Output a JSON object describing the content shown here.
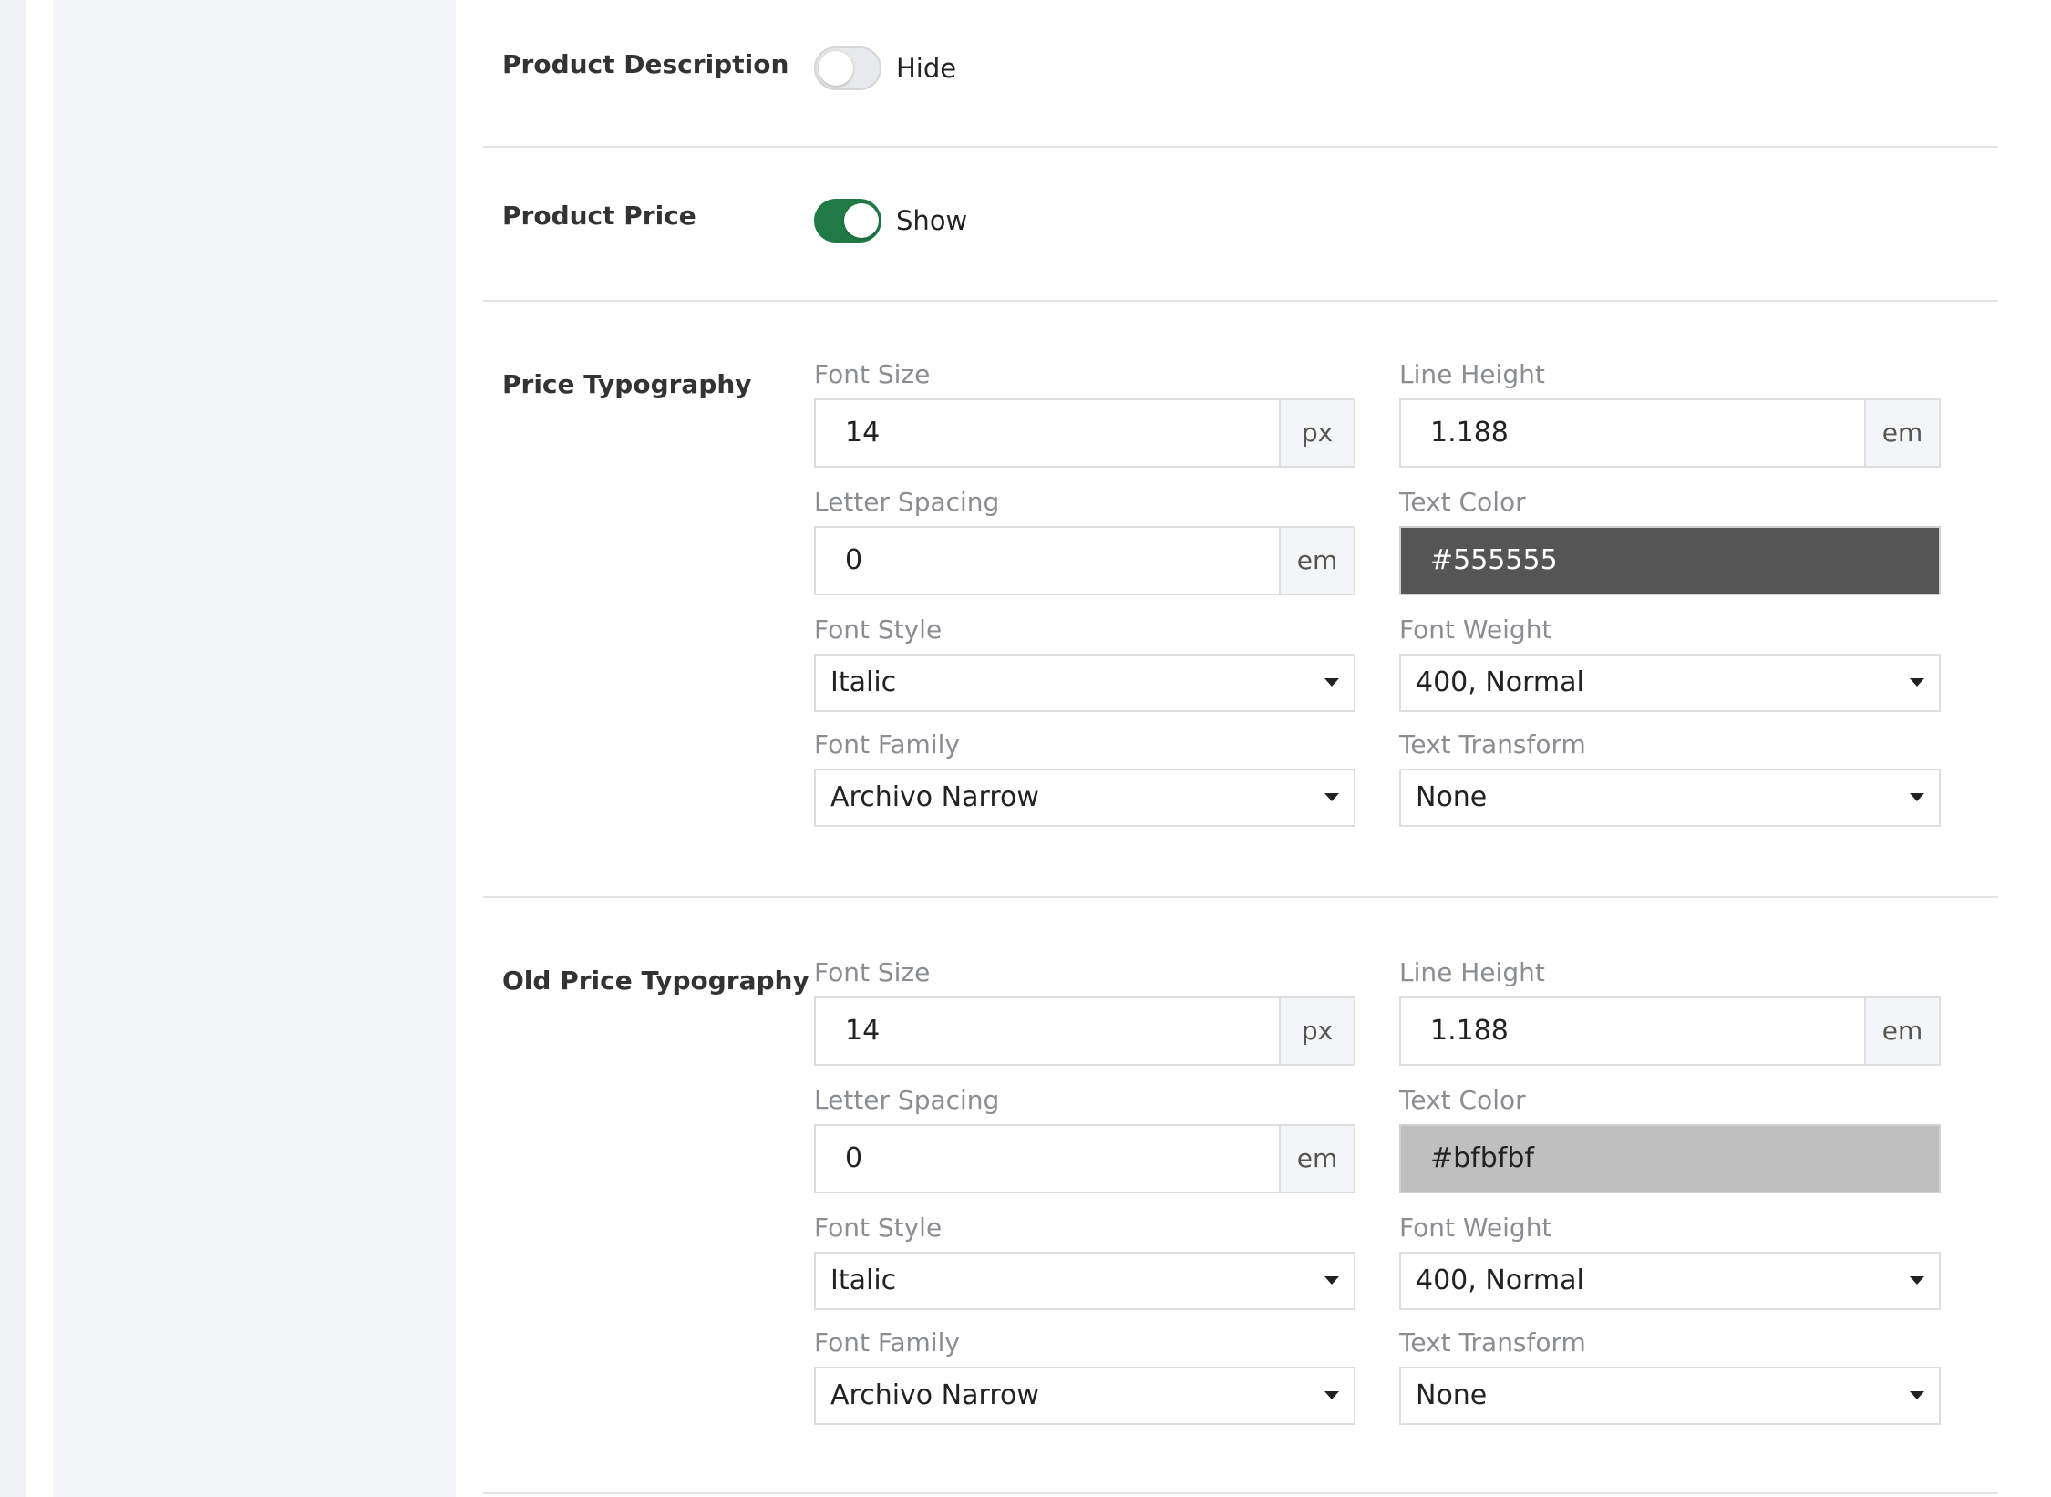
{
  "rows": {
    "product_description": {
      "label": "Product Description",
      "toggle_text": "Hide",
      "on": false
    },
    "product_price": {
      "label": "Product Price",
      "toggle_text": "Show",
      "on": true
    }
  },
  "price_typography": {
    "label": "Price Typography",
    "font_size": {
      "label": "Font Size",
      "value": "14",
      "unit": "px"
    },
    "line_height": {
      "label": "Line Height",
      "value": "1.188",
      "unit": "em"
    },
    "letter_spacing": {
      "label": "Letter Spacing",
      "value": "0",
      "unit": "em"
    },
    "text_color": {
      "label": "Text Color",
      "value": "#555555",
      "bg": "#555555",
      "fg": "#ffffff"
    },
    "font_style": {
      "label": "Font Style",
      "value": "Italic"
    },
    "font_weight": {
      "label": "Font Weight",
      "value": "400, Normal"
    },
    "font_family": {
      "label": "Font Family",
      "value": "Archivo Narrow"
    },
    "text_transform": {
      "label": "Text Transform",
      "value": "None"
    }
  },
  "old_price_typography": {
    "label": "Old Price Typography",
    "font_size": {
      "label": "Font Size",
      "value": "14",
      "unit": "px"
    },
    "line_height": {
      "label": "Line Height",
      "value": "1.188",
      "unit": "em"
    },
    "letter_spacing": {
      "label": "Letter Spacing",
      "value": "0",
      "unit": "em"
    },
    "text_color": {
      "label": "Text Color",
      "value": "#bfbfbf",
      "bg": "#bfbfbf",
      "fg": "#222222"
    },
    "font_style": {
      "label": "Font Style",
      "value": "Italic"
    },
    "font_weight": {
      "label": "Font Weight",
      "value": "400, Normal"
    },
    "font_family": {
      "label": "Font Family",
      "value": "Archivo Narrow"
    },
    "text_transform": {
      "label": "Text Transform",
      "value": "None"
    }
  },
  "colors": {
    "toggle_on": "#1f7a45",
    "divider": "#e2e4e7"
  }
}
